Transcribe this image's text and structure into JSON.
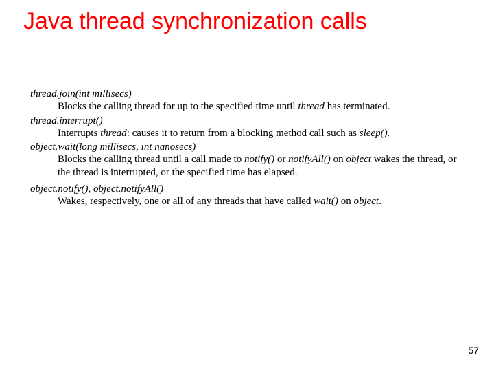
{
  "title": "Java thread synchronization calls",
  "entries": [
    {
      "sig": "thread.join(int millisecs)",
      "desc_pre": "Blocks the calling thread for up to the specified time until ",
      "desc_i1": "thread",
      "desc_post": " has terminated."
    },
    {
      "sig": "thread.interrupt()",
      "desc_pre": "Interrupts ",
      "desc_i1": "thread",
      "desc_mid": ": causes it to return from a blocking method call such as ",
      "desc_i2": "sleep().",
      "desc_post": ""
    },
    {
      "sig": "object.wait(long millisecs, int nanosecs)",
      "desc_pre": "Blocks the calling thread until a call made to ",
      "desc_i1": "notify()",
      "desc_mid": " or ",
      "desc_i2": "notifyAll()",
      "desc_mid2": " on ",
      "desc_i3": "object",
      "desc_post": " wakes the thread, or the thread is interrupted, or the specified time has elapsed."
    },
    {
      "sig": "object.notify(), object.notifyAll()",
      "desc_pre": "Wakes, respectively, one or all of any threads that have called ",
      "desc_i1": "wait()",
      "desc_mid": " on ",
      "desc_i2": "object",
      "desc_post": "."
    }
  ],
  "page_number": "57"
}
